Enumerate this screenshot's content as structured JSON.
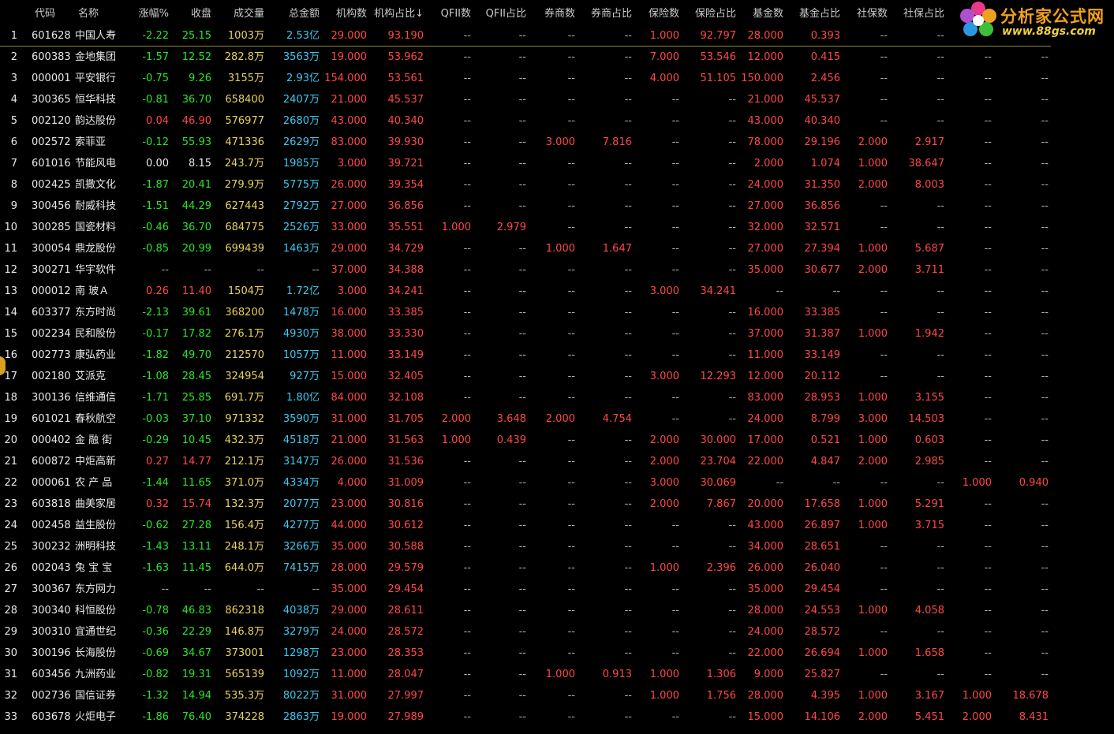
{
  "logo": {
    "title": "分析家公式网",
    "url": "www.88gs.com"
  },
  "colors": {
    "background": "#000000",
    "up": "#ff4848",
    "down": "#27e627",
    "neutral": "#e8e8e8",
    "volume": "#e8d25c",
    "amount": "#3ec8f0",
    "header": "#c8c8c8"
  },
  "headers": [
    "",
    "代码",
    "名称",
    "涨幅%",
    "收盘",
    "成交量",
    "总金额",
    "机构数",
    "机构占比↓",
    "QFII数",
    "QFII占比",
    "券商数",
    "券商占比",
    "保险数",
    "保险占比",
    "基金数",
    "基金占比",
    "社保数",
    "社保占比",
    "",
    ""
  ],
  "rows": [
    [
      "1",
      "601628",
      "中国人寿",
      "-2.22",
      "25.15",
      "1003万",
      "2.53亿",
      "29.000",
      "93.190",
      "--",
      "--",
      "--",
      "--",
      "1.000",
      "92.797",
      "28.000",
      "0.393",
      "--",
      "--",
      "--",
      "--"
    ],
    [
      "2",
      "600383",
      "金地集团",
      "-1.57",
      "12.52",
      "282.8万",
      "3563万",
      "19.000",
      "53.962",
      "--",
      "--",
      "--",
      "--",
      "7.000",
      "53.546",
      "12.000",
      "0.415",
      "--",
      "--",
      "--",
      "--"
    ],
    [
      "3",
      "000001",
      "平安银行",
      "-0.75",
      "9.26",
      "3155万",
      "2.93亿",
      "154.000",
      "53.561",
      "--",
      "--",
      "--",
      "--",
      "4.000",
      "51.105",
      "150.000",
      "2.456",
      "--",
      "--",
      "--",
      "--"
    ],
    [
      "4",
      "300365",
      "恒华科技",
      "-0.81",
      "36.70",
      "658400",
      "2407万",
      "21.000",
      "45.537",
      "--",
      "--",
      "--",
      "--",
      "--",
      "--",
      "21.000",
      "45.537",
      "--",
      "--",
      "--",
      "--"
    ],
    [
      "5",
      "002120",
      "韵达股份",
      "0.04",
      "46.90",
      "576977",
      "2680万",
      "43.000",
      "40.340",
      "--",
      "--",
      "--",
      "--",
      "--",
      "--",
      "43.000",
      "40.340",
      "--",
      "--",
      "--",
      "--"
    ],
    [
      "6",
      "002572",
      "索菲亚",
      "-0.12",
      "55.93",
      "471336",
      "2629万",
      "83.000",
      "39.930",
      "--",
      "--",
      "3.000",
      "7.816",
      "--",
      "--",
      "78.000",
      "29.196",
      "2.000",
      "2.917",
      "--",
      "--"
    ],
    [
      "7",
      "601016",
      "节能风电",
      "0.00",
      "8.15",
      "243.7万",
      "1985万",
      "3.000",
      "39.721",
      "--",
      "--",
      "--",
      "--",
      "--",
      "--",
      "2.000",
      "1.074",
      "1.000",
      "38.647",
      "--",
      "--"
    ],
    [
      "8",
      "002425",
      "凯撒文化",
      "-1.87",
      "20.41",
      "279.9万",
      "5775万",
      "26.000",
      "39.354",
      "--",
      "--",
      "--",
      "--",
      "--",
      "--",
      "24.000",
      "31.350",
      "2.000",
      "8.003",
      "--",
      "--"
    ],
    [
      "9",
      "300456",
      "耐威科技",
      "-1.51",
      "44.29",
      "627443",
      "2792万",
      "27.000",
      "36.856",
      "--",
      "--",
      "--",
      "--",
      "--",
      "--",
      "27.000",
      "36.856",
      "--",
      "--",
      "--",
      "--"
    ],
    [
      "10",
      "300285",
      "国瓷材料",
      "-0.46",
      "36.70",
      "684775",
      "2526万",
      "33.000",
      "35.551",
      "1.000",
      "2.979",
      "--",
      "--",
      "--",
      "--",
      "32.000",
      "32.571",
      "--",
      "--",
      "--",
      "--"
    ],
    [
      "11",
      "300054",
      "鼎龙股份",
      "-0.85",
      "20.99",
      "699439",
      "1463万",
      "29.000",
      "34.729",
      "--",
      "--",
      "1.000",
      "1.647",
      "--",
      "--",
      "27.000",
      "27.394",
      "1.000",
      "5.687",
      "--",
      "--"
    ],
    [
      "12",
      "300271",
      "华宇软件",
      "--",
      "--",
      "--",
      "--",
      "37.000",
      "34.388",
      "--",
      "--",
      "--",
      "--",
      "--",
      "--",
      "35.000",
      "30.677",
      "2.000",
      "3.711",
      "--",
      "--"
    ],
    [
      "13",
      "000012",
      "南 玻Ａ",
      "0.26",
      "11.40",
      "1504万",
      "1.72亿",
      "3.000",
      "34.241",
      "--",
      "--",
      "--",
      "--",
      "3.000",
      "34.241",
      "--",
      "--",
      "--",
      "--",
      "--",
      "--"
    ],
    [
      "14",
      "603377",
      "东方时尚",
      "-2.13",
      "39.61",
      "368200",
      "1478万",
      "16.000",
      "33.385",
      "--",
      "--",
      "--",
      "--",
      "--",
      "--",
      "16.000",
      "33.385",
      "--",
      "--",
      "--",
      "--"
    ],
    [
      "15",
      "002234",
      "民和股份",
      "-0.17",
      "17.82",
      "276.1万",
      "4930万",
      "38.000",
      "33.330",
      "--",
      "--",
      "--",
      "--",
      "--",
      "--",
      "37.000",
      "31.387",
      "1.000",
      "1.942",
      "--",
      "--"
    ],
    [
      "16",
      "002773",
      "康弘药业",
      "-1.82",
      "49.70",
      "212570",
      "1057万",
      "11.000",
      "33.149",
      "--",
      "--",
      "--",
      "--",
      "--",
      "--",
      "11.000",
      "33.149",
      "--",
      "--",
      "--",
      "--"
    ],
    [
      "17",
      "002180",
      "艾派克",
      "-1.08",
      "28.45",
      "324954",
      "927万",
      "15.000",
      "32.405",
      "--",
      "--",
      "--",
      "--",
      "3.000",
      "12.293",
      "12.000",
      "20.112",
      "--",
      "--",
      "--",
      "--"
    ],
    [
      "18",
      "300136",
      "信维通信",
      "-1.71",
      "25.85",
      "691.7万",
      "1.80亿",
      "84.000",
      "32.108",
      "--",
      "--",
      "--",
      "--",
      "--",
      "--",
      "83.000",
      "28.953",
      "1.000",
      "3.155",
      "--",
      "--"
    ],
    [
      "19",
      "601021",
      "春秋航空",
      "-0.03",
      "37.10",
      "971332",
      "3590万",
      "31.000",
      "31.705",
      "2.000",
      "3.648",
      "2.000",
      "4.754",
      "--",
      "--",
      "24.000",
      "8.799",
      "3.000",
      "14.503",
      "--",
      "--"
    ],
    [
      "20",
      "000402",
      "金 融 街",
      "-0.29",
      "10.45",
      "432.3万",
      "4518万",
      "21.000",
      "31.563",
      "1.000",
      "0.439",
      "--",
      "--",
      "2.000",
      "30.000",
      "17.000",
      "0.521",
      "1.000",
      "0.603",
      "--",
      "--"
    ],
    [
      "21",
      "600872",
      "中炬高新",
      "0.27",
      "14.77",
      "212.1万",
      "3147万",
      "26.000",
      "31.536",
      "--",
      "--",
      "--",
      "--",
      "2.000",
      "23.704",
      "22.000",
      "4.847",
      "2.000",
      "2.985",
      "--",
      "--"
    ],
    [
      "22",
      "000061",
      "农 产 品",
      "-1.44",
      "11.65",
      "371.0万",
      "4334万",
      "4.000",
      "31.009",
      "--",
      "--",
      "--",
      "--",
      "3.000",
      "30.069",
      "--",
      "--",
      "--",
      "--",
      "1.000",
      "0.940"
    ],
    [
      "23",
      "603818",
      "曲美家居",
      "0.32",
      "15.74",
      "132.3万",
      "2077万",
      "23.000",
      "30.816",
      "--",
      "--",
      "--",
      "--",
      "2.000",
      "7.867",
      "20.000",
      "17.658",
      "1.000",
      "5.291",
      "--",
      "--"
    ],
    [
      "24",
      "002458",
      "益生股份",
      "-0.62",
      "27.28",
      "156.4万",
      "4277万",
      "44.000",
      "30.612",
      "--",
      "--",
      "--",
      "--",
      "--",
      "--",
      "43.000",
      "26.897",
      "1.000",
      "3.715",
      "--",
      "--"
    ],
    [
      "25",
      "300232",
      "洲明科技",
      "-1.43",
      "13.11",
      "248.1万",
      "3266万",
      "35.000",
      "30.588",
      "--",
      "--",
      "--",
      "--",
      "--",
      "--",
      "34.000",
      "28.651",
      "--",
      "--",
      "--",
      "--"
    ],
    [
      "26",
      "002043",
      "兔 宝 宝",
      "-1.63",
      "11.45",
      "644.0万",
      "7415万",
      "28.000",
      "29.579",
      "--",
      "--",
      "--",
      "--",
      "1.000",
      "2.396",
      "26.000",
      "26.040",
      "--",
      "--",
      "--",
      "--"
    ],
    [
      "27",
      "300367",
      "东方网力",
      "--",
      "--",
      "--",
      "--",
      "35.000",
      "29.454",
      "--",
      "--",
      "--",
      "--",
      "--",
      "--",
      "35.000",
      "29.454",
      "--",
      "--",
      "--",
      "--"
    ],
    [
      "28",
      "300340",
      "科恒股份",
      "-0.78",
      "46.83",
      "862318",
      "4038万",
      "29.000",
      "28.611",
      "--",
      "--",
      "--",
      "--",
      "--",
      "--",
      "28.000",
      "24.553",
      "1.000",
      "4.058",
      "--",
      "--"
    ],
    [
      "29",
      "300310",
      "宜通世纪",
      "-0.36",
      "22.29",
      "146.8万",
      "3279万",
      "24.000",
      "28.572",
      "--",
      "--",
      "--",
      "--",
      "--",
      "--",
      "24.000",
      "28.572",
      "--",
      "--",
      "--",
      "--"
    ],
    [
      "30",
      "300196",
      "长海股份",
      "-0.69",
      "34.67",
      "373001",
      "1298万",
      "23.000",
      "28.353",
      "--",
      "--",
      "--",
      "--",
      "--",
      "--",
      "22.000",
      "26.694",
      "1.000",
      "1.658",
      "--",
      "--"
    ],
    [
      "31",
      "603456",
      "九洲药业",
      "-0.82",
      "19.31",
      "565139",
      "1092万",
      "11.000",
      "28.047",
      "--",
      "--",
      "1.000",
      "0.913",
      "1.000",
      "1.306",
      "9.000",
      "25.827",
      "--",
      "--",
      "--",
      "--"
    ],
    [
      "32",
      "002736",
      "国信证券",
      "-1.32",
      "14.94",
      "535.3万",
      "8022万",
      "31.000",
      "27.997",
      "--",
      "--",
      "--",
      "--",
      "1.000",
      "1.756",
      "28.000",
      "4.395",
      "1.000",
      "3.167",
      "1.000",
      "18.678"
    ],
    [
      "33",
      "603678",
      "火炬电子",
      "-1.86",
      "76.40",
      "374228",
      "2863万",
      "19.000",
      "27.989",
      "--",
      "--",
      "--",
      "--",
      "--",
      "--",
      "15.000",
      "14.106",
      "2.000",
      "5.451",
      "2.000",
      "8.431"
    ]
  ]
}
